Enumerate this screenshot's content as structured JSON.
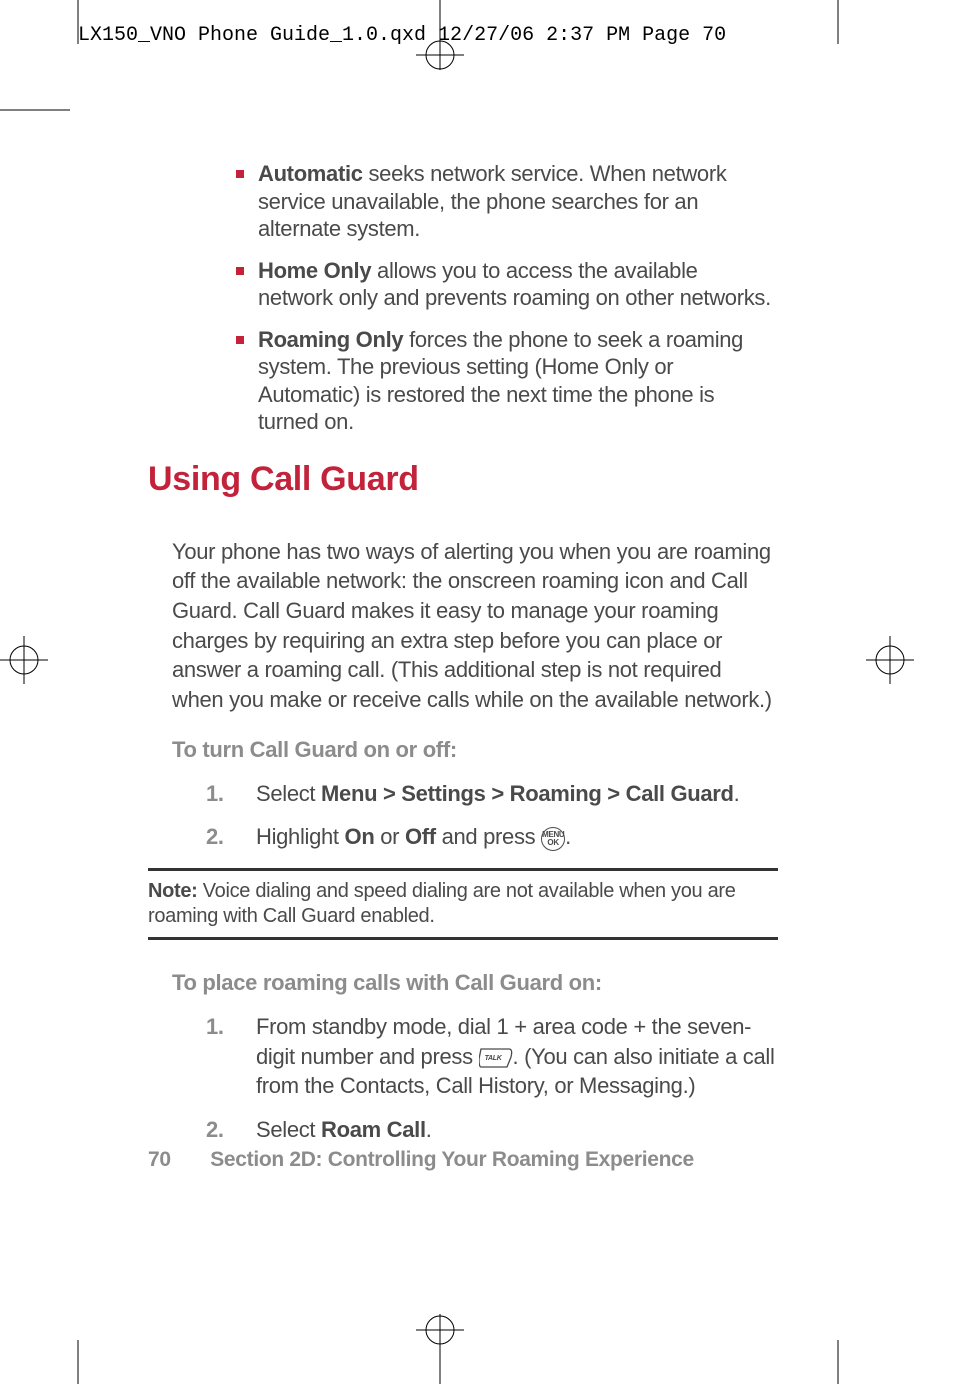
{
  "header_line": "LX150_VNO Phone Guide_1.0.qxd  12/27/06  2:37 PM  Page 70",
  "bullets": [
    {
      "term": "Automatic",
      "text": " seeks network service. When network service unavailable, the phone searches for an alternate system."
    },
    {
      "term": "Home Only",
      "text": " allows you to access the available network only and prevents roaming on other networks."
    },
    {
      "term": "Roaming Only",
      "text": " forces the phone to seek a roaming system. The previous setting (Home Only or Automatic) is restored the next time the phone is turned on."
    }
  ],
  "section_title": "Using Call Guard",
  "intro_paragraph": "Your phone has two ways of alerting you when you are roaming off the available network: the onscreen roaming icon and Call Guard. Call Guard makes it easy to manage your roaming charges by requiring an extra step before you can place or answer a roaming call. (This additional step is not required when you make or receive calls while on the available network.)",
  "sub1": "To turn Call Guard on or off:",
  "list1": {
    "item1_num": "1.",
    "item1_pre": "Select ",
    "item1_bold": "Menu > Settings > Roaming > Call Guard",
    "item1_post": ".",
    "item2_num": "2.",
    "item2_pre": "Highlight ",
    "item2_b1": "On",
    "item2_mid": " or ",
    "item2_b2": "Off",
    "item2_post1": " and press ",
    "item2_icon": "MENU OK",
    "item2_post2": "."
  },
  "note_label": "Note:",
  "note_text": " Voice dialing and speed dialing are not available when you are roaming with Call Guard enabled.",
  "sub2": "To place roaming calls with Call Guard on:",
  "list2": {
    "item1_num": "1.",
    "item1_pre": "From standby mode, dial 1 + area code + the seven-digit number and press ",
    "item1_icon": "TALK",
    "item1_post": ". (You can also initiate a call from the Contacts, Call History, or Messaging.)",
    "item2_num": "2.",
    "item2_pre": "Select ",
    "item2_bold": "Roam Call",
    "item2_post": "."
  },
  "footer_page": "70",
  "footer_text": "Section 2D: Controlling Your Roaming Experience"
}
